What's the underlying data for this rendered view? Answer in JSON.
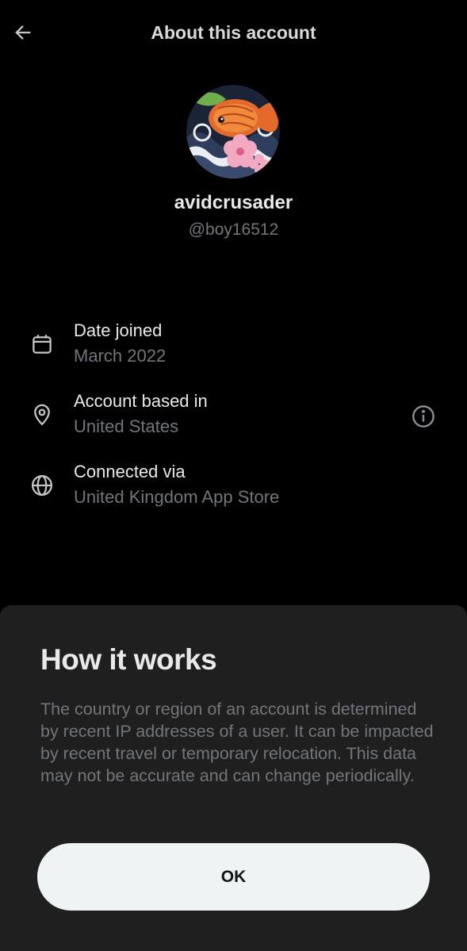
{
  "header": {
    "title": "About this account",
    "back_icon": "arrow-left-icon"
  },
  "profile": {
    "display_name": "avidcrusader",
    "handle": "@boy16512",
    "avatar_icon": "koi-fish-avatar"
  },
  "details": [
    {
      "icon": "calendar-icon",
      "label": "Date joined",
      "value": "March 2022"
    },
    {
      "icon": "location-pin-icon",
      "label": "Account based in",
      "value": "United States",
      "info_icon": "info-icon"
    },
    {
      "icon": "globe-icon",
      "label": "Connected via",
      "value": "United Kingdom App Store"
    }
  ],
  "sheet": {
    "title": "How it works",
    "body": "The country or region of an account is determined by recent IP addresses of a user. It can be impacted by recent travel or temporary relocation. This data may not be accurate and can change periodically.",
    "ok_label": "OK"
  },
  "colors": {
    "background": "#000000",
    "sheet_background": "#1f1f1f",
    "primary_text": "#e7e9ea",
    "secondary_text": "#71767b",
    "button_background": "#eff3f4"
  }
}
